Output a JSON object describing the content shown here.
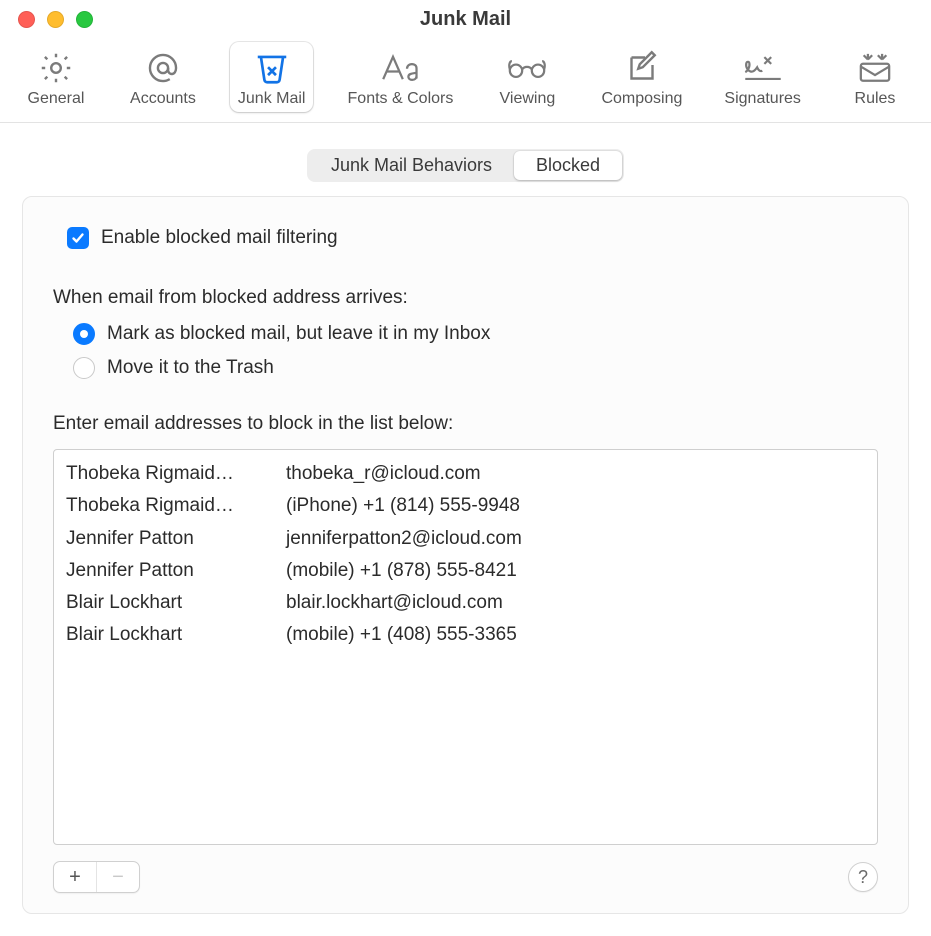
{
  "window": {
    "title": "Junk Mail"
  },
  "toolbar": {
    "items": [
      {
        "label": "General"
      },
      {
        "label": "Accounts"
      },
      {
        "label": "Junk Mail"
      },
      {
        "label": "Fonts & Colors"
      },
      {
        "label": "Viewing"
      },
      {
        "label": "Composing"
      },
      {
        "label": "Signatures"
      },
      {
        "label": "Rules"
      }
    ],
    "active_index": 2
  },
  "tabs": {
    "behaviors": "Junk Mail Behaviors",
    "blocked": "Blocked",
    "selected": "blocked"
  },
  "enable": {
    "checked": true,
    "label": "Enable blocked mail filtering"
  },
  "arrives": {
    "heading": "When email from blocked address arrives:",
    "options": [
      {
        "label": "Mark as blocked mail, but leave it in my Inbox",
        "selected": true
      },
      {
        "label": "Move it to the Trash",
        "selected": false
      }
    ]
  },
  "list": {
    "heading": "Enter email addresses to block in the list below:",
    "rows": [
      {
        "name": "Thobeka Rigmaid…",
        "contact": "thobeka_r@icloud.com"
      },
      {
        "name": "Thobeka Rigmaid…",
        "contact": "(iPhone) +1 (814) 555-9948"
      },
      {
        "name": "Jennifer Patton",
        "contact": "jenniferpatton2@icloud.com"
      },
      {
        "name": "Jennifer Patton",
        "contact": "(mobile) +1 (878) 555-8421"
      },
      {
        "name": "Blair Lockhart",
        "contact": "blair.lockhart@icloud.com"
      },
      {
        "name": "Blair Lockhart",
        "contact": "(mobile) +1 (408) 555-3365"
      }
    ]
  },
  "footer": {
    "add": "+",
    "remove": "−",
    "help": "?"
  }
}
